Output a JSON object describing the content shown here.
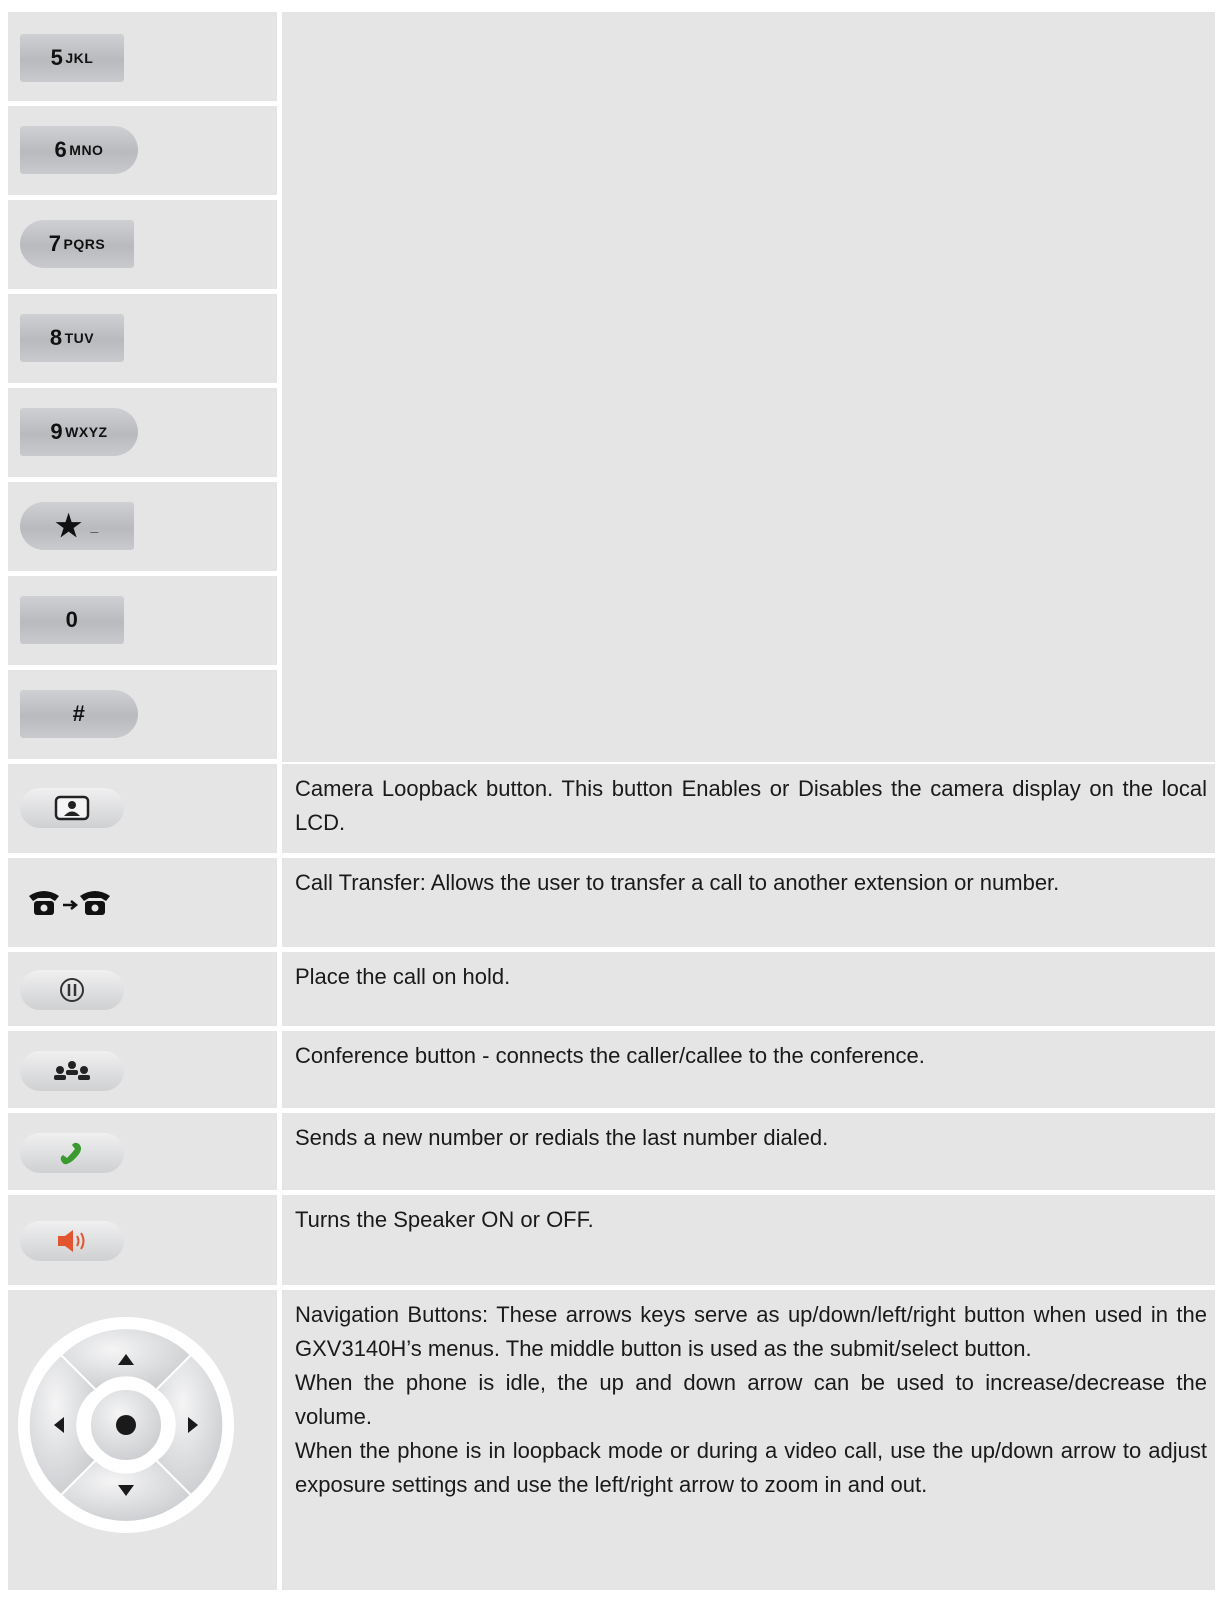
{
  "keys": [
    {
      "digit": "5",
      "letters": "JKL",
      "icon": "key-5-icon"
    },
    {
      "digit": "6",
      "letters": "MNO",
      "icon": "key-6-icon"
    },
    {
      "digit": "7",
      "letters": "PQRS",
      "icon": "key-7-icon"
    },
    {
      "digit": "8",
      "letters": "TUV",
      "icon": "key-8-icon"
    },
    {
      "digit": "9",
      "letters": "WXYZ",
      "icon": "key-9-icon"
    },
    {
      "digit": "★",
      "letters": "_",
      "icon": "key-star-icon"
    },
    {
      "digit": "0",
      "letters": "",
      "icon": "key-0-icon"
    },
    {
      "digit": "#",
      "letters": "",
      "icon": "key-hash-icon"
    }
  ],
  "functions": [
    {
      "icon": "camera-loopback-icon",
      "desc": "Camera Loopback button. This button Enables or Disables the camera display on the local LCD."
    },
    {
      "icon": "call-transfer-icon",
      "desc": "Call Transfer: Allows the user to transfer a call to another extension or number."
    },
    {
      "icon": "hold-icon",
      "desc": "Place the call on hold."
    },
    {
      "icon": "conference-icon",
      "desc": "Conference button - connects the caller/callee to the conference."
    },
    {
      "icon": "send-call-icon",
      "desc": "Sends a new number or redials the last number dialed."
    },
    {
      "icon": "speaker-icon",
      "desc": "Turns the Speaker ON or OFF."
    }
  ],
  "navigation": {
    "icon": "navigation-pad-icon",
    "para1": "Navigation Buttons: These arrows keys serve as up/down/left/right button when used in the GXV3140H’s menus. The middle button is used as the submit/select button.",
    "para2": "When the phone is idle, the up and down arrow can be used to increase/decrease the volume.",
    "para3": "When the phone is in loopback mode or during a video call, use the up/down arrow to adjust exposure settings and use the left/right arrow to zoom in and out."
  },
  "colors": {
    "cell": "#e5e5e5",
    "send_green": "#3a9a2f",
    "speaker_red": "#e2552e"
  }
}
